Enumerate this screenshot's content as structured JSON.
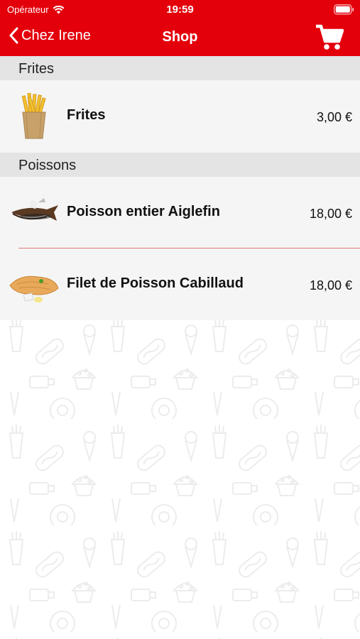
{
  "status_bar": {
    "carrier": "Opérateur",
    "time": "19:59"
  },
  "navbar": {
    "back_label": "Chez Irene",
    "title": "Shop",
    "icons": {
      "back": "chevron-left-icon",
      "cart": "shopping-cart-icon"
    }
  },
  "colors": {
    "brand_red": "#e3000b",
    "section_bg": "#e4e4e4",
    "row_bg": "#f5f5f5",
    "divider": "#e07a7a"
  },
  "sections": [
    {
      "title": "Frites",
      "items": [
        {
          "name": "Frites",
          "price": "3,00 €",
          "icon": "fries-image"
        }
      ]
    },
    {
      "title": "Poissons",
      "items": [
        {
          "name": "Poisson entier Aiglefin",
          "price": "18,00 €",
          "icon": "whole-fish-image"
        },
        {
          "name": "Filet de Poisson Cabillaud",
          "price": "18,00 €",
          "icon": "fish-fillet-image"
        }
      ]
    }
  ]
}
